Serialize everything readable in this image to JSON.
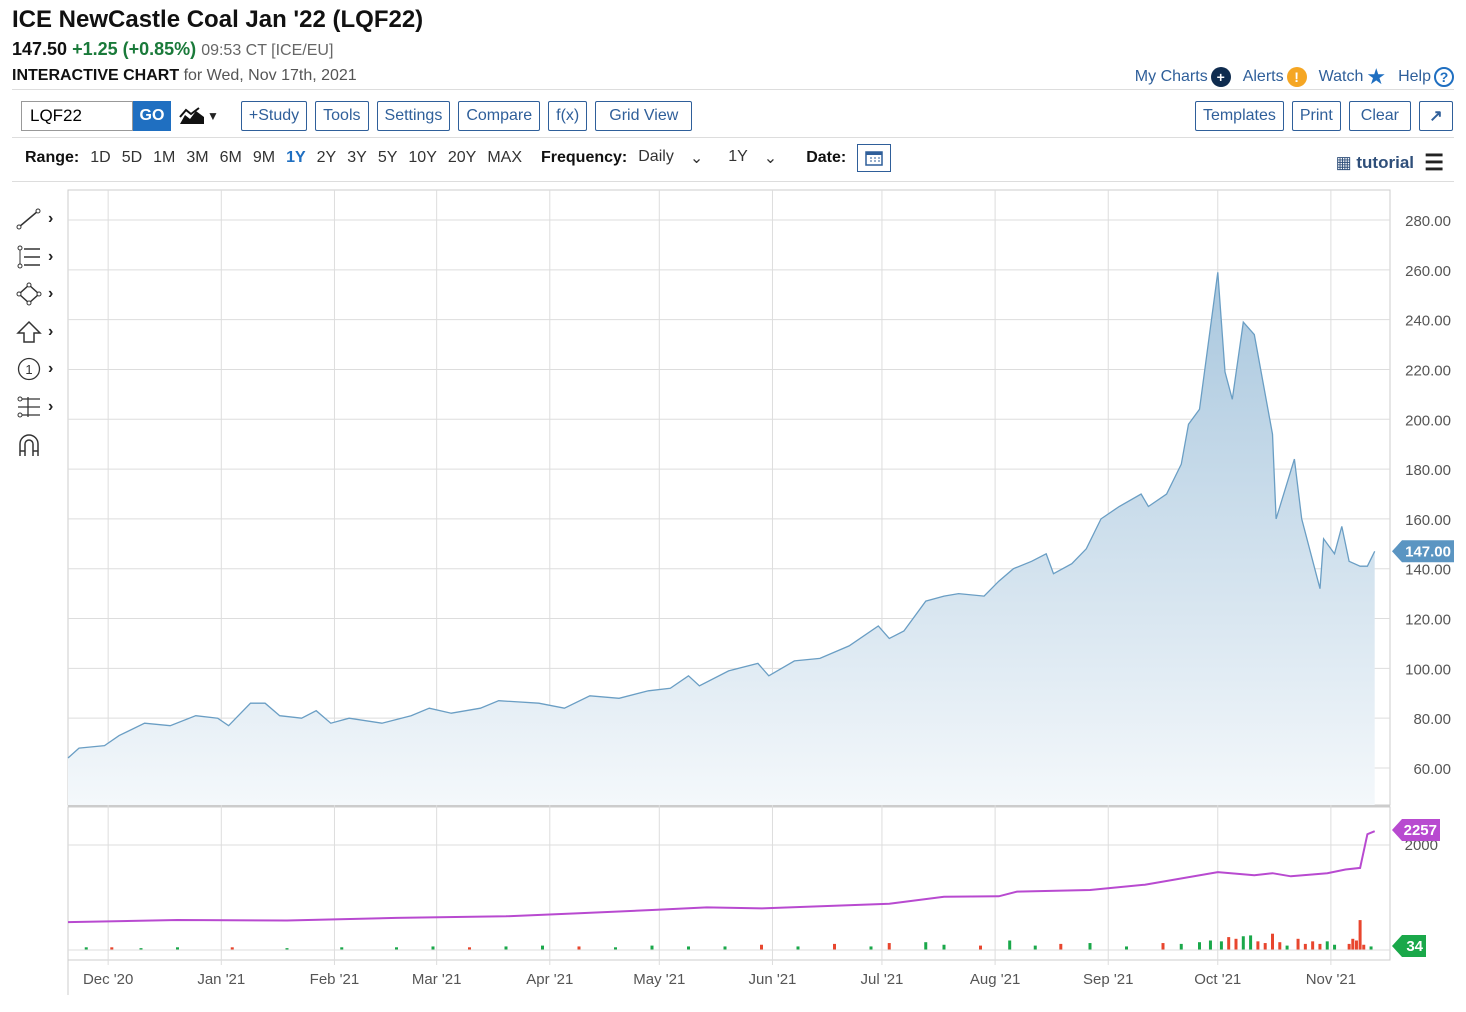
{
  "header": {
    "title": "ICE NewCastle Coal Jan '22 (LQF22)",
    "last": "147.50",
    "change": "+1.25 (+0.85%)",
    "time": "09:53 CT [ICE/EU]",
    "chart_label": "INTERACTIVE CHART",
    "chart_date": "for Wed, Nov 17th, 2021"
  },
  "links": {
    "my_charts": "My Charts",
    "alerts": "Alerts",
    "watch": "Watch",
    "help": "Help"
  },
  "toolbar": {
    "symbol": "LQF22",
    "go": "GO",
    "study": "+Study",
    "tools": "Tools",
    "settings": "Settings",
    "compare": "Compare",
    "fx": "f(x)",
    "grid": "Grid View",
    "templates": "Templates",
    "print": "Print",
    "clear": "Clear",
    "expand": "↗"
  },
  "range": {
    "label": "Range:",
    "options": [
      "1D",
      "5D",
      "1M",
      "3M",
      "6M",
      "9M",
      "1Y",
      "2Y",
      "3Y",
      "5Y",
      "10Y",
      "20Y",
      "MAX"
    ],
    "selected": "1Y",
    "frequency_label": "Frequency:",
    "frequency": "Daily",
    "period": "1Y",
    "date_label": "Date:"
  },
  "tutorial": "tutorial",
  "colors": {
    "accent": "#1f6fc1",
    "price_line": "#6a9ec4",
    "oi": "#b84ad0",
    "up": "#1aa84a",
    "down": "#e8462e"
  },
  "chart_data": {
    "type": "area",
    "start_date": "2020-11-20",
    "y_ticks": [
      "280.00",
      "260.00",
      "240.00",
      "220.00",
      "200.00",
      "180.00",
      "160.00",
      "140.00",
      "120.00",
      "100.00",
      "80.00",
      "60.00"
    ],
    "ylim": [
      50,
      290
    ],
    "price_label": "147.00",
    "x_ticks": [
      {
        "day": 11,
        "label": "Dec '20"
      },
      {
        "day": 42,
        "label": "Jan '21"
      },
      {
        "day": 73,
        "label": "Feb '21"
      },
      {
        "day": 101,
        "label": "Mar '21"
      },
      {
        "day": 132,
        "label": "Apr '21"
      },
      {
        "day": 162,
        "label": "May '21"
      },
      {
        "day": 193,
        "label": "Jun '21"
      },
      {
        "day": 223,
        "label": "Jul '21"
      },
      {
        "day": 254,
        "label": "Aug '21"
      },
      {
        "day": 285,
        "label": "Sep '21"
      },
      {
        "day": 315,
        "label": "Oct '21"
      },
      {
        "day": 346,
        "label": "Nov '21"
      }
    ],
    "price": [
      [
        0,
        64
      ],
      [
        3,
        68
      ],
      [
        10,
        69
      ],
      [
        14,
        73
      ],
      [
        21,
        78
      ],
      [
        28,
        77
      ],
      [
        35,
        81
      ],
      [
        41,
        80
      ],
      [
        44,
        77
      ],
      [
        50,
        86
      ],
      [
        54,
        86
      ],
      [
        58,
        81
      ],
      [
        64,
        80
      ],
      [
        68,
        83
      ],
      [
        72,
        78
      ],
      [
        77,
        80
      ],
      [
        86,
        78
      ],
      [
        94,
        81
      ],
      [
        99,
        84
      ],
      [
        105,
        82
      ],
      [
        113,
        84
      ],
      [
        118,
        87
      ],
      [
        129,
        86
      ],
      [
        136,
        84
      ],
      [
        143,
        89
      ],
      [
        151,
        88
      ],
      [
        159,
        91
      ],
      [
        165,
        92
      ],
      [
        170,
        97
      ],
      [
        173,
        93
      ],
      [
        181,
        99
      ],
      [
        189,
        102
      ],
      [
        192,
        97
      ],
      [
        199,
        103
      ],
      [
        206,
        104
      ],
      [
        214,
        109
      ],
      [
        222,
        117
      ],
      [
        225,
        112
      ],
      [
        229,
        115
      ],
      [
        235,
        127
      ],
      [
        240,
        129
      ],
      [
        244,
        130
      ],
      [
        251,
        129
      ],
      [
        255,
        135
      ],
      [
        259,
        140
      ],
      [
        264,
        143
      ],
      [
        268,
        146
      ],
      [
        270,
        138
      ],
      [
        275,
        142
      ],
      [
        279,
        148
      ],
      [
        283,
        160
      ],
      [
        288,
        165
      ],
      [
        294,
        170
      ],
      [
        296,
        165
      ],
      [
        301,
        170
      ],
      [
        305,
        182
      ],
      [
        307,
        198
      ],
      [
        310,
        204
      ],
      [
        315,
        259
      ],
      [
        317,
        219
      ],
      [
        319,
        208
      ],
      [
        322,
        239
      ],
      [
        325,
        234
      ],
      [
        330,
        194
      ],
      [
        331,
        160
      ],
      [
        336,
        184
      ],
      [
        338,
        160
      ],
      [
        343,
        132
      ],
      [
        344,
        152
      ],
      [
        347,
        146
      ],
      [
        349,
        157
      ],
      [
        351,
        143
      ],
      [
        354,
        141
      ],
      [
        356,
        141
      ],
      [
        358,
        147
      ]
    ],
    "oi_tick": "2000",
    "oi_label": "2257",
    "open_interest": [
      [
        0,
        530
      ],
      [
        30,
        570
      ],
      [
        60,
        560
      ],
      [
        90,
        610
      ],
      [
        120,
        640
      ],
      [
        140,
        700
      ],
      [
        160,
        760
      ],
      [
        175,
        810
      ],
      [
        190,
        790
      ],
      [
        210,
        840
      ],
      [
        225,
        880
      ],
      [
        240,
        1010
      ],
      [
        255,
        1020
      ],
      [
        260,
        1110
      ],
      [
        280,
        1140
      ],
      [
        295,
        1240
      ],
      [
        315,
        1480
      ],
      [
        325,
        1420
      ],
      [
        330,
        1460
      ],
      [
        335,
        1400
      ],
      [
        345,
        1460
      ],
      [
        350,
        1530
      ],
      [
        354,
        1560
      ],
      [
        356,
        2200
      ],
      [
        358,
        2257
      ]
    ],
    "volume_label": "34",
    "volume": [
      [
        5,
        2,
        "u"
      ],
      [
        12,
        2,
        "d"
      ],
      [
        20,
        1,
        "u"
      ],
      [
        30,
        2,
        "u"
      ],
      [
        45,
        2,
        "d"
      ],
      [
        60,
        1,
        "u"
      ],
      [
        75,
        2,
        "u"
      ],
      [
        90,
        2,
        "u"
      ],
      [
        100,
        3,
        "u"
      ],
      [
        110,
        2,
        "d"
      ],
      [
        120,
        3,
        "u"
      ],
      [
        130,
        4,
        "u"
      ],
      [
        140,
        3,
        "d"
      ],
      [
        150,
        2,
        "u"
      ],
      [
        160,
        4,
        "u"
      ],
      [
        170,
        3,
        "u"
      ],
      [
        180,
        3,
        "u"
      ],
      [
        190,
        5,
        "d"
      ],
      [
        200,
        3,
        "u"
      ],
      [
        210,
        6,
        "d"
      ],
      [
        220,
        3,
        "u"
      ],
      [
        225,
        7,
        "d"
      ],
      [
        235,
        8,
        "u"
      ],
      [
        240,
        5,
        "u"
      ],
      [
        250,
        4,
        "d"
      ],
      [
        258,
        10,
        "u"
      ],
      [
        265,
        4,
        "u"
      ],
      [
        272,
        6,
        "d"
      ],
      [
        280,
        7,
        "u"
      ],
      [
        290,
        3,
        "u"
      ],
      [
        300,
        7,
        "d"
      ],
      [
        305,
        6,
        "u"
      ],
      [
        310,
        8,
        "u"
      ],
      [
        313,
        10,
        "u"
      ],
      [
        316,
        9,
        "u"
      ],
      [
        318,
        14,
        "d"
      ],
      [
        320,
        12,
        "d"
      ],
      [
        322,
        15,
        "u"
      ],
      [
        324,
        16,
        "u"
      ],
      [
        326,
        9,
        "d"
      ],
      [
        328,
        7,
        "d"
      ],
      [
        330,
        18,
        "d"
      ],
      [
        332,
        8,
        "d"
      ],
      [
        334,
        4,
        "u"
      ],
      [
        337,
        12,
        "d"
      ],
      [
        339,
        6,
        "d"
      ],
      [
        341,
        9,
        "d"
      ],
      [
        343,
        6,
        "d"
      ],
      [
        345,
        9,
        "u"
      ],
      [
        347,
        5,
        "u"
      ],
      [
        351,
        6,
        "d"
      ],
      [
        352,
        12,
        "d"
      ],
      [
        353,
        10,
        "d"
      ],
      [
        354,
        34,
        "d"
      ],
      [
        355,
        5,
        "d"
      ],
      [
        357,
        3,
        "u"
      ]
    ]
  }
}
